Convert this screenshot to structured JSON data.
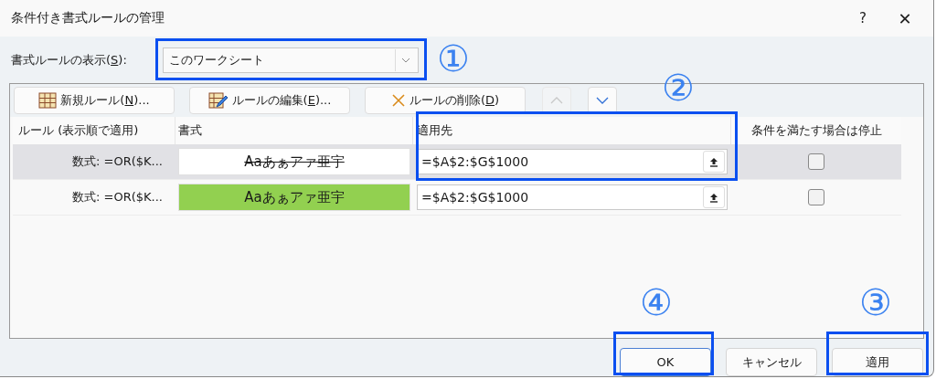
{
  "window": {
    "title": "条件付き書式ルールの管理",
    "help": "?",
    "close": "✕"
  },
  "show_rules": {
    "label": "書式ルールの表示(",
    "mnemonic": "S",
    "label_end": "):",
    "value": "このワークシート"
  },
  "toolbar": [
    {
      "kind": "new",
      "label": "新規ルール(",
      "mnemonic": "N",
      "label_end": ")..."
    },
    {
      "kind": "edit",
      "label": "ルールの編集(",
      "mnemonic": "E",
      "label_end": ")..."
    },
    {
      "kind": "delete",
      "label": "ルールの削除(",
      "mnemonic": "D",
      "label_end": ")"
    },
    {
      "kind": "up",
      "disabled": true
    },
    {
      "kind": "down",
      "disabled": false
    }
  ],
  "table": {
    "columns": [
      "ルール (表示順で適用)",
      "書式",
      "適用先",
      "条件を満たす場合は停止"
    ],
    "rows": [
      {
        "rule": "数式: =OR($K...",
        "preview": "Aaあぁアァ亜宇",
        "strikethrough": true,
        "color": "#ffffff",
        "applies_to": "=$A$2:$G$1000",
        "stop": false,
        "selected": true
      },
      {
        "rule": "数式: =OR($K...",
        "preview": "Aaあぁアァ亜宇",
        "strikethrough": false,
        "color": "#92d050",
        "applies_to": "=$A$2:$G$1000",
        "stop": false,
        "selected": false
      }
    ]
  },
  "buttons": [
    {
      "label": "OK",
      "default": true
    },
    {
      "label": "キャンセル",
      "default": false
    },
    {
      "label": "適用",
      "default": false
    }
  ],
  "annotations": [
    "①",
    "②",
    "④",
    "③"
  ]
}
